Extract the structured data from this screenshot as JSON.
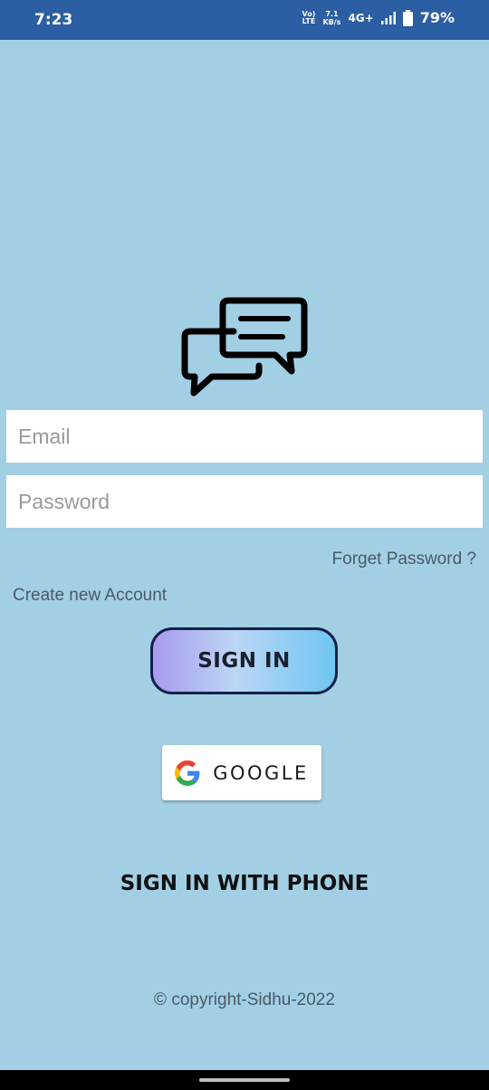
{
  "status_bar": {
    "time": "7:23",
    "volte": [
      "Vo)",
      "LTE"
    ],
    "net_speed": [
      "7.1",
      "KB/s"
    ],
    "network": "4G+",
    "battery": "79%"
  },
  "logo": {
    "icon": "chat-bubbles-icon"
  },
  "form": {
    "email_placeholder": "Email",
    "email_value": "",
    "password_placeholder": "Password",
    "password_value": ""
  },
  "links": {
    "forget_password": "Forget Password ?",
    "create_account": "Create new Account"
  },
  "buttons": {
    "sign_in": "SIGN IN",
    "google": "GOOGLE",
    "sign_in_phone": "SIGN IN WITH PHONE"
  },
  "footer": {
    "copyright": "© copyright-Sidhu-2022"
  },
  "colors": {
    "background": "#a2cfe4",
    "status_bar": "#2b5ea2",
    "signin_border": "#15204a"
  }
}
